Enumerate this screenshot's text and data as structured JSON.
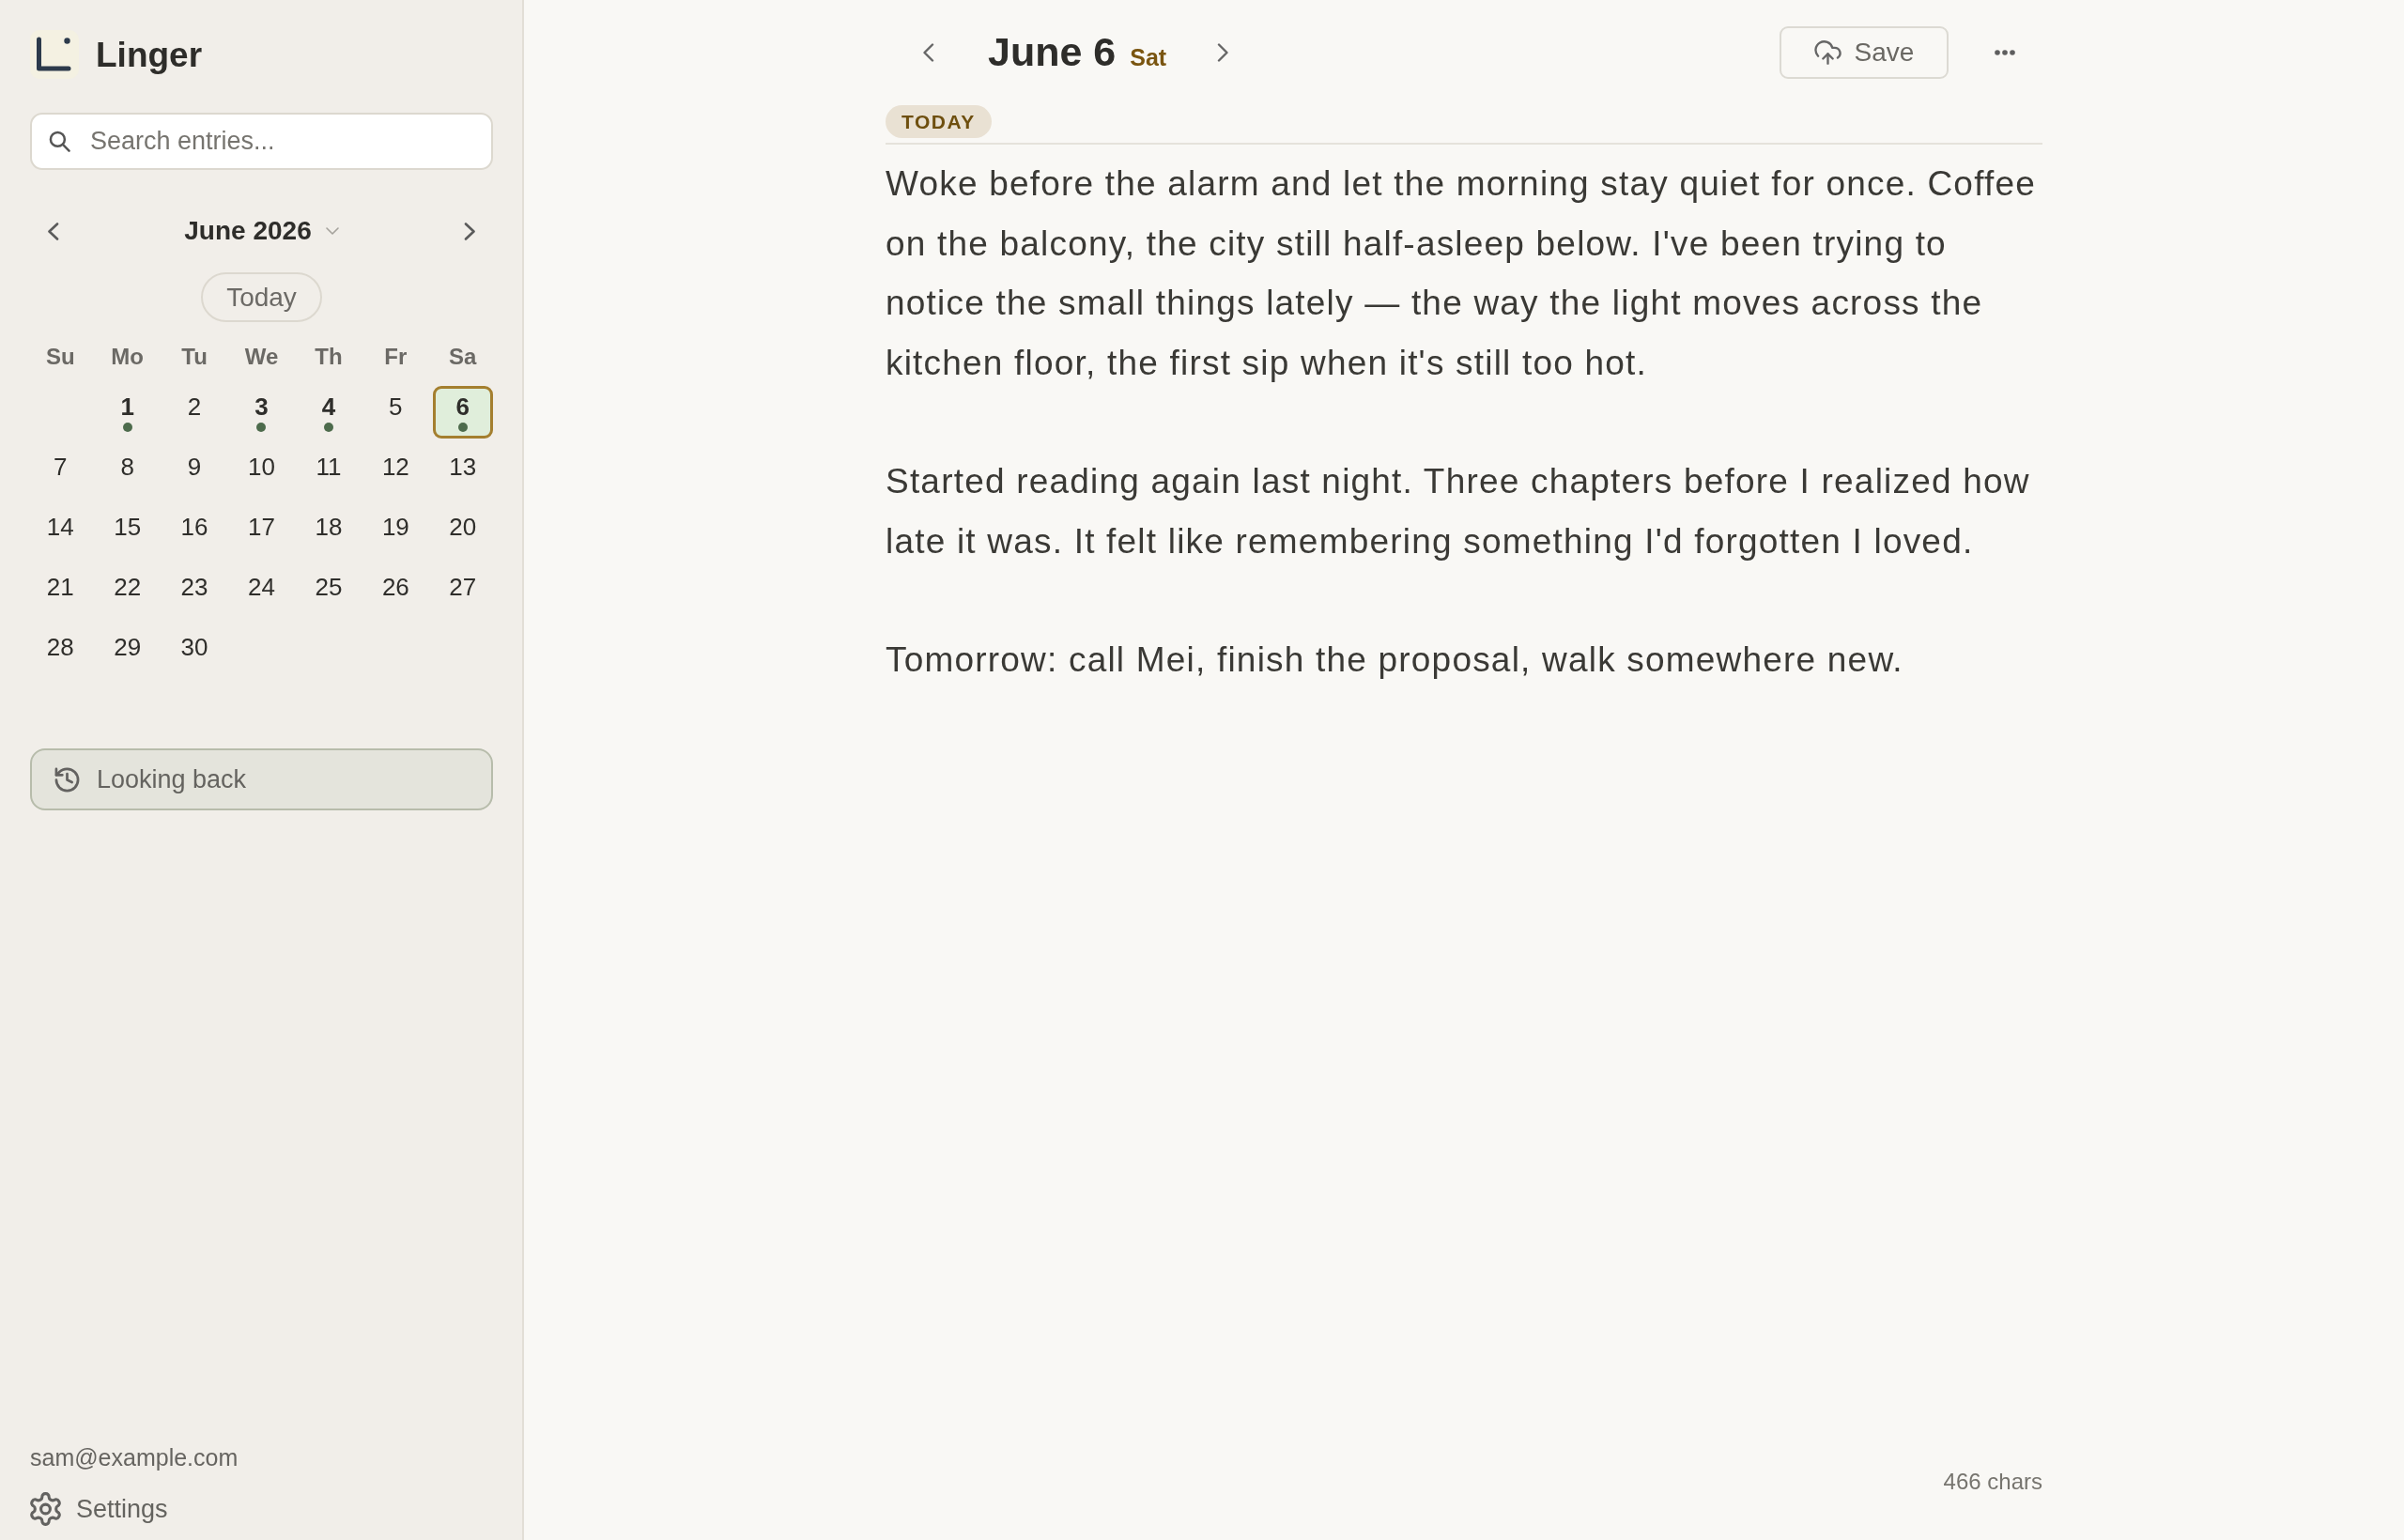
{
  "sidebar": {
    "app_name": "Linger",
    "search": {
      "placeholder": "Search entries..."
    },
    "calendar": {
      "month_label": "June 2026",
      "today_button": "Today",
      "weekdays": [
        "Su",
        "Mo",
        "Tu",
        "We",
        "Th",
        "Fr",
        "Sa"
      ],
      "weeks": [
        {
          "days": [
            {
              "kind": "blank"
            },
            {
              "kind": "day",
              "label": "1",
              "has_entry": true,
              "selected": false
            },
            {
              "kind": "day",
              "label": "2",
              "has_entry": false,
              "selected": false
            },
            {
              "kind": "day",
              "label": "3",
              "has_entry": true,
              "selected": false
            },
            {
              "kind": "day",
              "label": "4",
              "has_entry": true,
              "selected": false
            },
            {
              "kind": "day",
              "label": "5",
              "has_entry": false,
              "selected": false
            },
            {
              "kind": "day",
              "label": "6",
              "has_entry": true,
              "selected": true
            }
          ]
        },
        {
          "days": [
            {
              "kind": "day",
              "label": "7",
              "has_entry": false,
              "selected": false
            },
            {
              "kind": "day",
              "label": "8",
              "has_entry": false,
              "selected": false
            },
            {
              "kind": "day",
              "label": "9",
              "has_entry": false,
              "selected": false
            },
            {
              "kind": "day",
              "label": "10",
              "has_entry": false,
              "selected": false
            },
            {
              "kind": "day",
              "label": "11",
              "has_entry": false,
              "selected": false
            },
            {
              "kind": "day",
              "label": "12",
              "has_entry": false,
              "selected": false
            },
            {
              "kind": "day",
              "label": "13",
              "has_entry": false,
              "selected": false
            }
          ]
        },
        {
          "days": [
            {
              "kind": "day",
              "label": "14",
              "has_entry": false,
              "selected": false
            },
            {
              "kind": "day",
              "label": "15",
              "has_entry": false,
              "selected": false
            },
            {
              "kind": "day",
              "label": "16",
              "has_entry": false,
              "selected": false
            },
            {
              "kind": "day",
              "label": "17",
              "has_entry": false,
              "selected": false
            },
            {
              "kind": "day",
              "label": "18",
              "has_entry": false,
              "selected": false
            },
            {
              "kind": "day",
              "label": "19",
              "has_entry": false,
              "selected": false
            },
            {
              "kind": "day",
              "label": "20",
              "has_entry": false,
              "selected": false
            }
          ]
        },
        {
          "days": [
            {
              "kind": "day",
              "label": "21",
              "has_entry": false,
              "selected": false
            },
            {
              "kind": "day",
              "label": "22",
              "has_entry": false,
              "selected": false
            },
            {
              "kind": "day",
              "label": "23",
              "has_entry": false,
              "selected": false
            },
            {
              "kind": "day",
              "label": "24",
              "has_entry": false,
              "selected": false
            },
            {
              "kind": "day",
              "label": "25",
              "has_entry": false,
              "selected": false
            },
            {
              "kind": "day",
              "label": "26",
              "has_entry": false,
              "selected": false
            },
            {
              "kind": "day",
              "label": "27",
              "has_entry": false,
              "selected": false
            }
          ]
        },
        {
          "days": [
            {
              "kind": "day",
              "label": "28",
              "has_entry": false,
              "selected": false
            },
            {
              "kind": "day",
              "label": "29",
              "has_entry": false,
              "selected": false
            },
            {
              "kind": "day",
              "label": "30",
              "has_entry": false,
              "selected": false
            }
          ]
        }
      ]
    },
    "looking_back_button": "Looking back",
    "account_email": "sam@example.com",
    "settings_label": "Settings"
  },
  "entry": {
    "date_title": "June 6",
    "weekday": "Sat",
    "save_button": "Save",
    "badge": "TODAY",
    "paragraphs": [
      "Woke before the alarm and let the morning stay quiet for once. Coffee on the balcony, the city still half-asleep below. I've been trying to notice the small things lately — the way the light moves across the kitchen floor, the first sip when it's still too hot.",
      "Started reading again last night. Three chapters before I realized how late it was. It felt like remembering something I'd forgotten I loved.",
      "Tomorrow: call Mei, finish the proposal, walk somewhere new."
    ],
    "char_count": "466 chars"
  }
}
